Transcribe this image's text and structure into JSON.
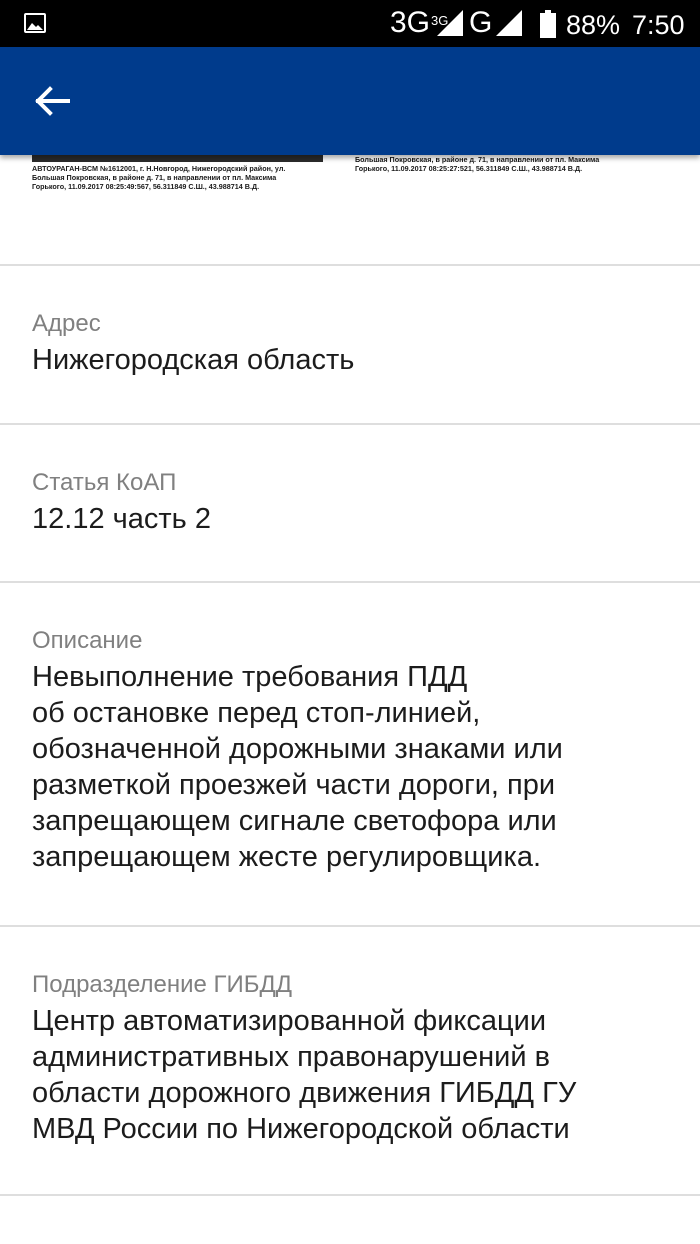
{
  "status_bar": {
    "network_1": "3G",
    "network_1_sup": "3G",
    "network_2": "G",
    "battery": "88%",
    "time": "7:50"
  },
  "app_bar": {
    "back_icon": "arrow-back-icon",
    "bg_color": "#003b8c"
  },
  "photos": {
    "left_caption": "АВТОУРАГАН-ВСМ №1612001, г. Н.Новгород, Нижегородский район, ул.\nБольшая Покровская, в районе д. 71, в направлении от пл. Максима\nГорького, 11.09.2017 08:25:49:567, 56.311849 С.Ш., 43.988714 В.Д.",
    "right_caption": "Большая Покровская, в районе д. 71, в направлении от пл. Максима\nГорького, 11.09.2017 08:25:27:521, 56.311849 С.Ш., 43.988714 В.Д."
  },
  "fields": [
    {
      "label": "Адрес",
      "value": "Нижегородская область"
    },
    {
      "label": "Статья КоАП",
      "value": "12.12 часть 2"
    },
    {
      "label": "Описание",
      "value": "Невыполнение требования ПДД\nоб остановке перед стоп-линией,\nобозначенной дорожными знаками или\nразметкой проезжей части дороги, при\nзапрещающем сигнале светофора или\nзапрещающем жесте регулировщика."
    },
    {
      "label": "Подразделение ГИБДД",
      "value": "Центр автоматизированной фиксации\nадминистративных правонарушений в\nобласти дорожного движения ГИБДД ГУ\nМВД России по Нижегородской области"
    }
  ]
}
